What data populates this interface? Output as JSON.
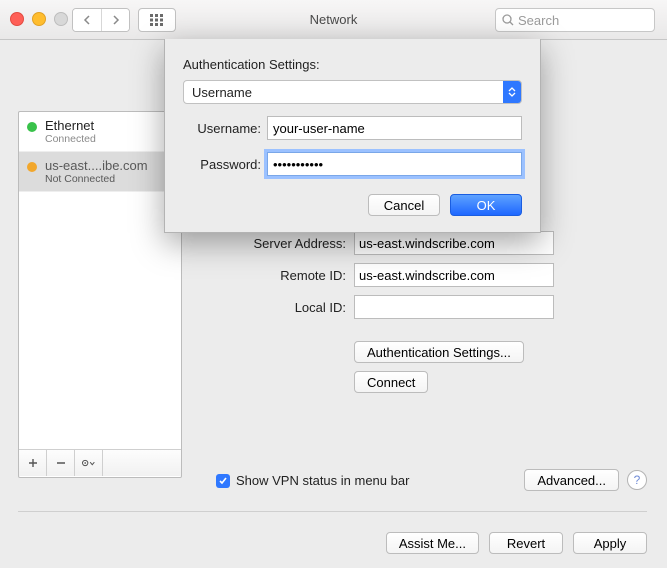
{
  "window": {
    "title": "Network"
  },
  "search": {
    "placeholder": "Search"
  },
  "interfaces": [
    {
      "name": "Ethernet",
      "status": "Connected",
      "dot": "green",
      "selected": false
    },
    {
      "name": "us-east....ibe.com",
      "status": "Not Connected",
      "dot": "orange",
      "selected": true
    }
  ],
  "detail": {
    "server_address_label": "Server Address:",
    "server_address_value": "us-east.windscribe.com",
    "remote_id_label": "Remote ID:",
    "remote_id_value": "us-east.windscribe.com",
    "local_id_label": "Local ID:",
    "local_id_value": "",
    "auth_settings_btn": "Authentication Settings...",
    "connect_btn": "Connect",
    "vpn_status_label": "Show VPN status in menu bar",
    "vpn_status_checked": true,
    "advanced_btn": "Advanced..."
  },
  "bottom": {
    "assist": "Assist Me...",
    "revert": "Revert",
    "apply": "Apply"
  },
  "sheet": {
    "title": "Authentication Settings:",
    "method_selected": "Username",
    "username_label": "Username:",
    "username_value": "your-user-name",
    "password_label": "Password:",
    "password_value": "•••••••••••",
    "cancel": "Cancel",
    "ok": "OK"
  }
}
